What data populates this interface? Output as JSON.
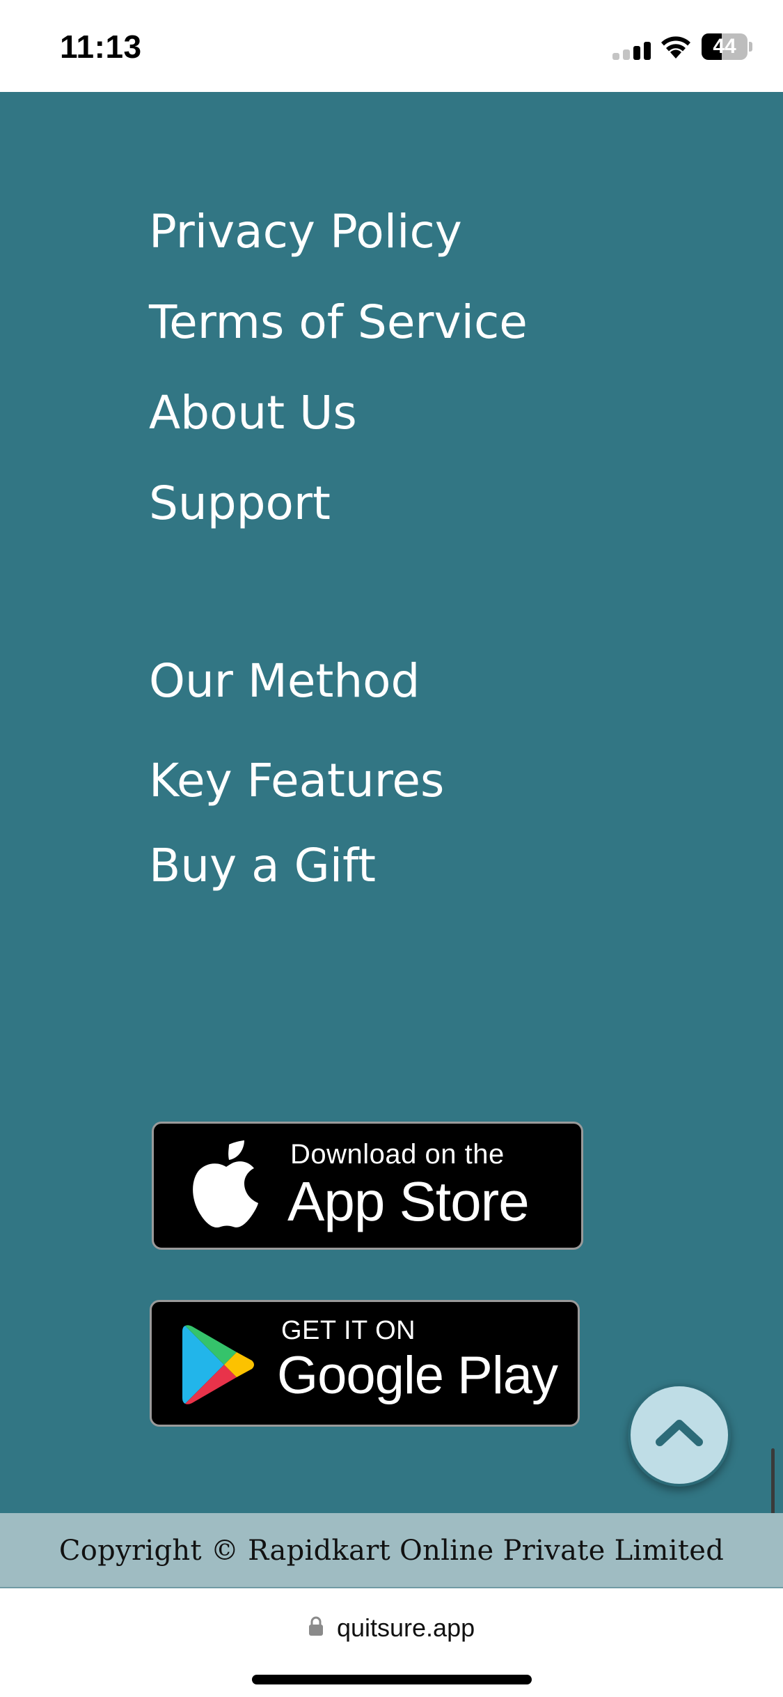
{
  "status_bar": {
    "time": "11:13",
    "battery_level": "44",
    "battery_fraction": 0.44,
    "icons": [
      "cellular-signal-icon",
      "wifi-icon",
      "battery-icon"
    ]
  },
  "footer": {
    "background_color": "#327684",
    "links_group_1": [
      {
        "label": "Privacy Policy"
      },
      {
        "label": "Terms of Service"
      },
      {
        "label": "About Us"
      },
      {
        "label": "Support"
      }
    ],
    "links_group_2": [
      {
        "label": "Our Method"
      },
      {
        "label": "Key Features"
      },
      {
        "label": "Buy a Gift"
      }
    ],
    "app_store_badge": {
      "small_text": "Download on the",
      "big_text": "App Store",
      "icon": "apple-icon"
    },
    "google_play_badge": {
      "small_text": "GET IT ON",
      "big_text": "Google Play",
      "icon": "google-play-icon"
    },
    "back_to_top": {
      "icon": "chevron-up-icon"
    }
  },
  "copyright": {
    "text": "Copyright © Rapidkart Online Private Limited",
    "background_color": "#9fbcc2"
  },
  "browser": {
    "url": "quitsure.app",
    "icon": "lock-icon"
  }
}
